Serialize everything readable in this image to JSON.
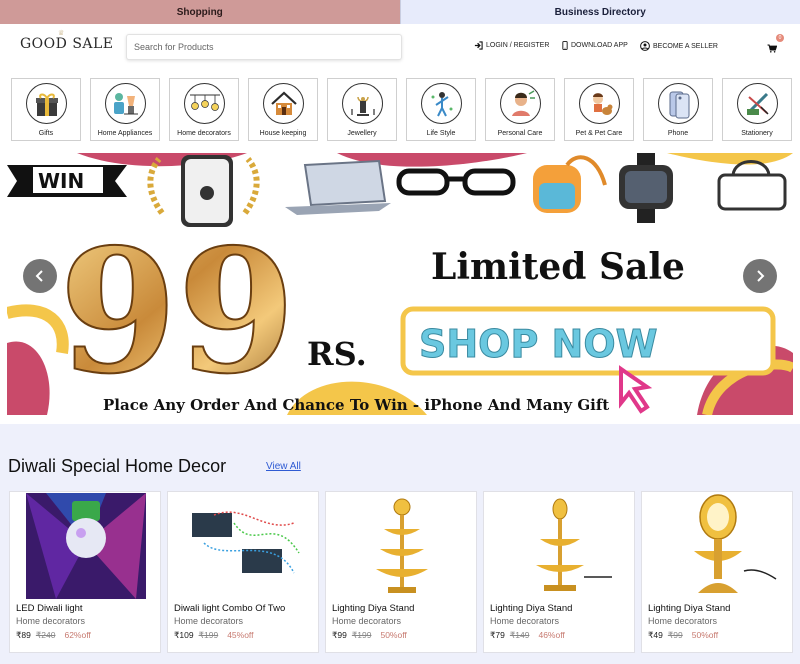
{
  "tabs": {
    "shopping": "Shopping",
    "business": "Business Directory"
  },
  "header": {
    "logo": "GOOD SALE",
    "search_placeholder": "Search for Products",
    "login": "LOGIN / REGISTER",
    "download": "DOWNLOAD APP",
    "seller": "BECOME A SELLER",
    "cart_count": "0"
  },
  "categories": [
    {
      "label": "Gifts",
      "icon": "gift-icon"
    },
    {
      "label": "Home Appliances",
      "icon": "appliances-icon"
    },
    {
      "label": "Home decorators",
      "icon": "decor-icon"
    },
    {
      "label": "House keeping",
      "icon": "house-icon"
    },
    {
      "label": "Jewellery",
      "icon": "jewellery-icon"
    },
    {
      "label": "Life Style",
      "icon": "lifestyle-icon"
    },
    {
      "label": "Personal Care",
      "icon": "personal-care-icon"
    },
    {
      "label": "Pet & Pet Care",
      "icon": "pet-icon"
    },
    {
      "label": "Phone",
      "icon": "phone-icon"
    },
    {
      "label": "Stationery",
      "icon": "stationery-icon"
    }
  ],
  "banner": {
    "badge": "WIN",
    "price": "99",
    "currency": "RS.",
    "headline": "Limited Sale",
    "cta": "SHOP NOW",
    "footer": "Place Any Order And Chance To Win - iPhone And Many Gift"
  },
  "section": {
    "title": "Diwali Special Home Decor",
    "view_all": "View All",
    "products": [
      {
        "name": "LED Diwali light",
        "category": "Home decorators",
        "price": "₹89",
        "mrp": "₹240",
        "off": "62%off"
      },
      {
        "name": "Diwali light Combo Of Two",
        "category": "Home decorators",
        "price": "₹109",
        "mrp": "₹199",
        "off": "45%off"
      },
      {
        "name": "Lighting Diya Stand",
        "category": "Home decorators",
        "price": "₹99",
        "mrp": "₹199",
        "off": "50%off"
      },
      {
        "name": "Lighting Diya Stand",
        "category": "Home decorators",
        "price": "₹79",
        "mrp": "₹149",
        "off": "46%off"
      },
      {
        "name": "Lighting Diya Stand",
        "category": "Home decorators",
        "price": "₹49",
        "mrp": "₹99",
        "off": "50%off"
      }
    ]
  },
  "colors": {
    "shopping_tab": "#cf9a98",
    "business_tab": "#e7ebfb",
    "accent_link": "#2f5bd3",
    "discount": "#c77a70",
    "section_bg": "#eef0fb"
  }
}
